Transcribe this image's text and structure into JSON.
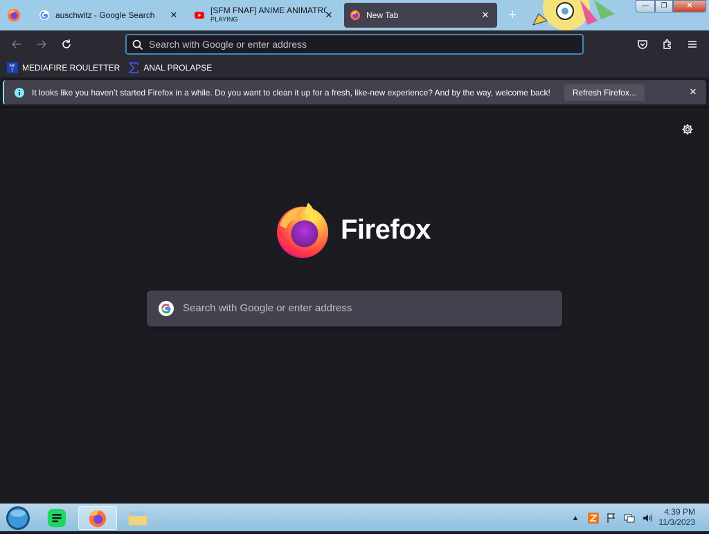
{
  "tabs": [
    {
      "title": "auschwitz - Google Search",
      "favicon": "google-g-icon"
    },
    {
      "title": "[SFM FNAF] ANIME ANIMATRO",
      "subtitle": "PLAYING",
      "favicon": "youtube-icon"
    },
    {
      "title": "New Tab",
      "favicon": "firefox-icon",
      "active": true
    }
  ],
  "urlbar": {
    "placeholder": "Search with Google or enter address"
  },
  "bookmarks": [
    {
      "label": "MEDIAFIRE ROULETTER",
      "icon": "mft-icon"
    },
    {
      "label": "ANAL PROLAPSE",
      "icon": "sigma-icon"
    }
  ],
  "notification": {
    "message": "It looks like you haven’t started Firefox in a while. Do you want to clean it up for a fresh, like-new experience? And by the way, welcome back!",
    "button": "Refresh Firefox..."
  },
  "newtab": {
    "wordmark": "Firefox",
    "search_placeholder": "Search with Google or enter address"
  },
  "taskbar": {
    "time": "4:39 PM",
    "date": "11/3/2023"
  },
  "colors": {
    "tabbar": "#9ecbe8",
    "toolbar": "#2b2a33",
    "content": "#1c1b22",
    "accent": "#3f89b8"
  }
}
